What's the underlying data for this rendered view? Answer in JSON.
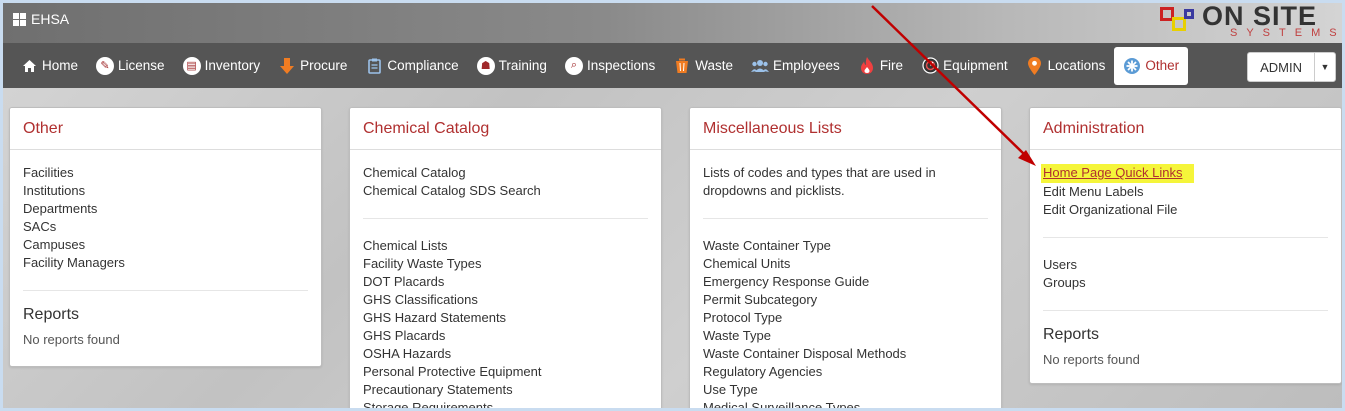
{
  "app": {
    "title": "EHSA"
  },
  "logo": {
    "text": "ON SITE",
    "sub": "SYSTEMS"
  },
  "nav": [
    {
      "label": "Home",
      "icon": "home-icon"
    },
    {
      "label": "License",
      "icon": "license-icon"
    },
    {
      "label": "Inventory",
      "icon": "inventory-icon"
    },
    {
      "label": "Procure",
      "icon": "procure-icon"
    },
    {
      "label": "Compliance",
      "icon": "compliance-icon"
    },
    {
      "label": "Training",
      "icon": "training-icon"
    },
    {
      "label": "Inspections",
      "icon": "inspections-icon"
    },
    {
      "label": "Waste",
      "icon": "waste-icon"
    },
    {
      "label": "Employees",
      "icon": "employees-icon"
    },
    {
      "label": "Fire",
      "icon": "fire-icon"
    },
    {
      "label": "Equipment",
      "icon": "equipment-icon"
    },
    {
      "label": "Locations",
      "icon": "locations-icon"
    },
    {
      "label": "Other",
      "icon": "other-icon",
      "active": true
    }
  ],
  "user_menu": {
    "label": "ADMIN"
  },
  "panels": {
    "other": {
      "title": "Other",
      "items": [
        "Facilities",
        "Institutions",
        "Departments",
        "SACs",
        "Campuses",
        "Facility Managers"
      ],
      "reports_title": "Reports",
      "reports_empty": "No reports found"
    },
    "chemical_catalog": {
      "title": "Chemical Catalog",
      "top_items": [
        "Chemical Catalog",
        "Chemical Catalog SDS Search"
      ],
      "items": [
        "Chemical Lists",
        "Facility Waste Types",
        "DOT Placards",
        "GHS Classifications",
        "GHS Hazard Statements",
        "GHS Placards",
        "OSHA Hazards",
        "Personal Protective Equipment",
        "Precautionary Statements",
        "Storage Requirements"
      ]
    },
    "misc_lists": {
      "title": "Miscellaneous Lists",
      "description": "Lists of codes and types that are used in dropdowns and picklists.",
      "items": [
        "Waste Container Type",
        "Chemical Units",
        "Emergency Response Guide",
        "Permit Subcategory",
        "Protocol Type",
        "Waste Type",
        "Waste Container Disposal Methods",
        "Regulatory Agencies",
        "Use Type",
        "Medical Surveillance Types"
      ]
    },
    "administration": {
      "title": "Administration",
      "highlighted_link": "Home Page Quick Links",
      "items": [
        "Edit Menu Labels",
        "Edit Organizational File"
      ],
      "user_items": [
        "Users",
        "Groups"
      ],
      "reports_title": "Reports",
      "reports_empty": "No reports found"
    }
  },
  "colors": {
    "accent": "#b03030",
    "nav_bg": "#555555",
    "highlight": "#f5f53a",
    "annotation_arrow": "#c00000"
  }
}
